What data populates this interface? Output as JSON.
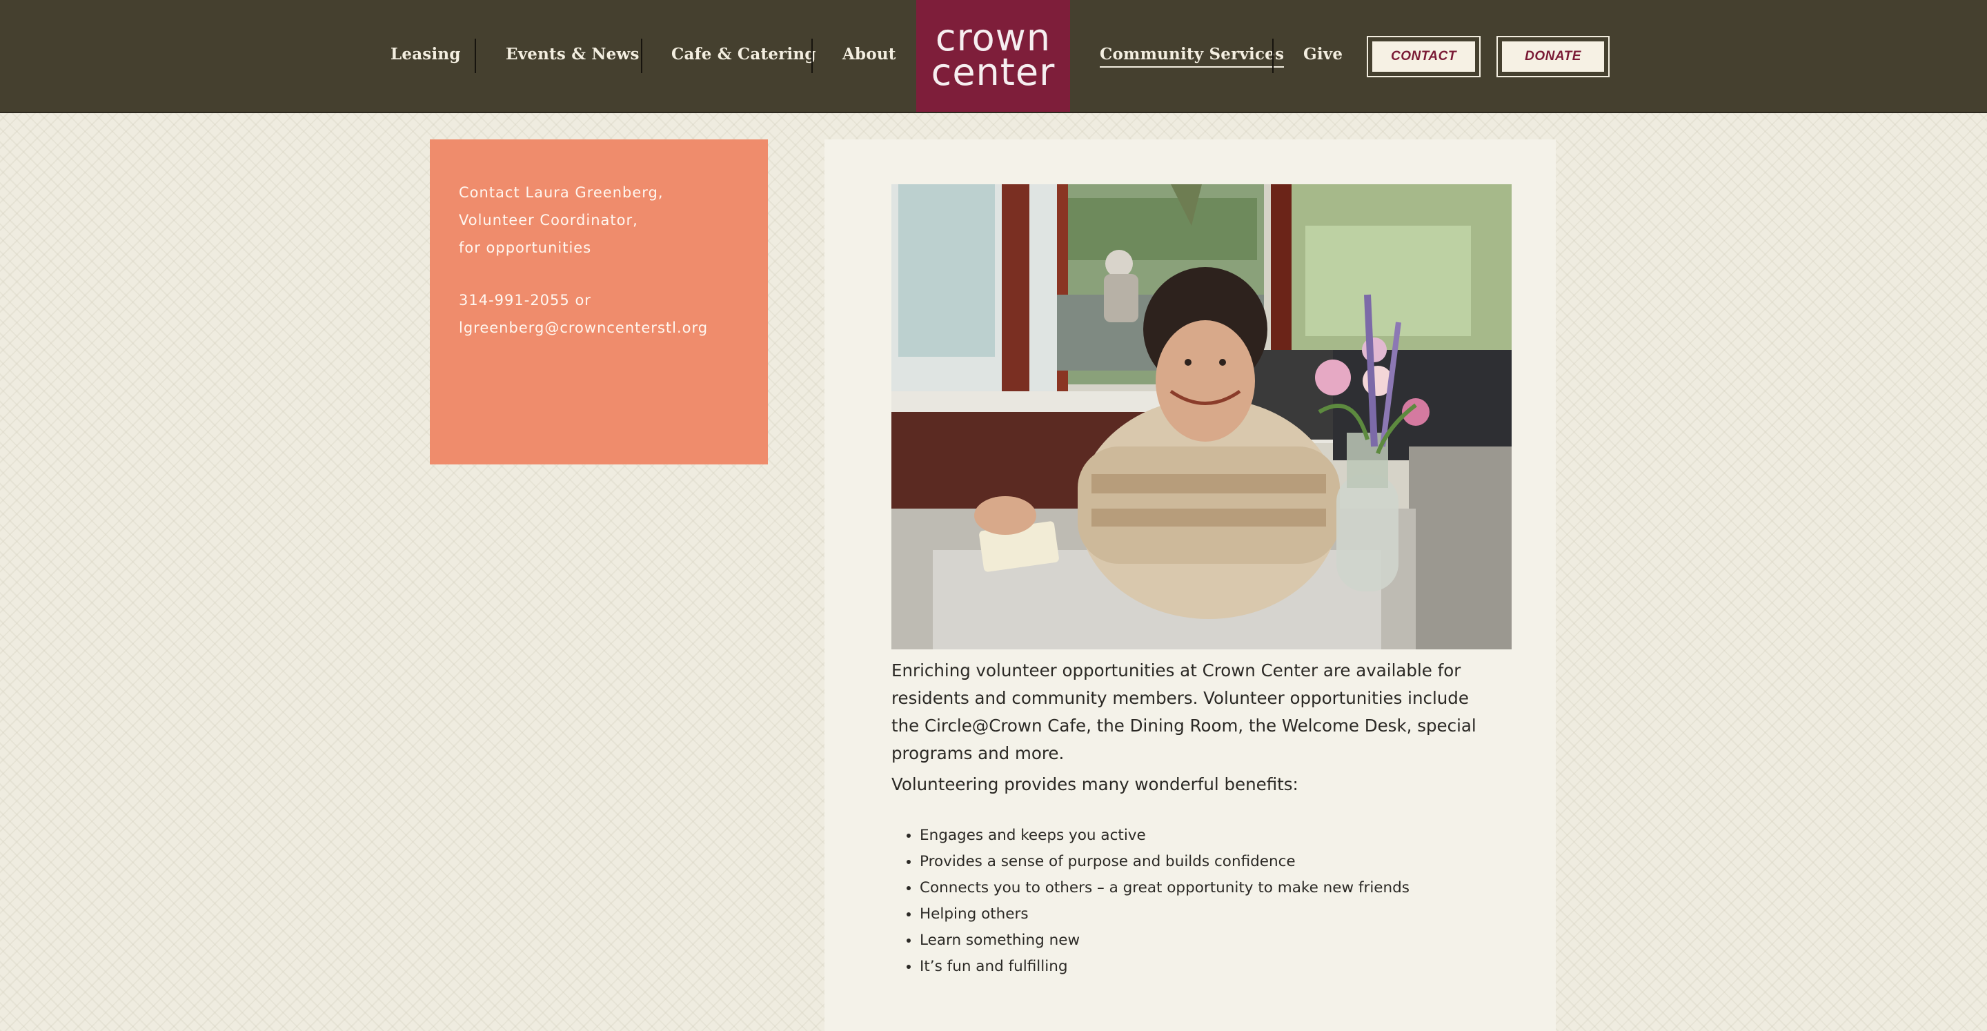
{
  "nav": {
    "items": [
      {
        "label": "Leasing"
      },
      {
        "label": "Events & News"
      },
      {
        "label": "Cafe & Catering"
      },
      {
        "label": "About"
      },
      {
        "label": "Community Services",
        "active": true
      },
      {
        "label": "Give"
      }
    ],
    "logo": {
      "line1": "crown",
      "line2": "center"
    },
    "contact_label": "CONTACT",
    "donate_label": "DONATE"
  },
  "sidebar": {
    "contact_lines": [
      "Contact Laura Greenberg,",
      "Volunteer Coordinator,",
      "for opportunities"
    ],
    "phone_line": "314-991-2055 or",
    "email": "lgreenberg@crowncenterstl.org"
  },
  "main": {
    "photo_alt": "Smiling volunteer seated at a cafe table with a vase of flowers",
    "intro": "Enriching volunteer opportunities at Crown Center are available for residents and community members. Volunteer opportunities include the Circle@Crown Cafe, the Dining Room, the Welcome Desk, special programs and more.",
    "benefits_title": "Volunteering provides many wonderful benefits:",
    "benefits": [
      "Engages and keeps you active",
      "Provides a sense of purpose and builds confidence",
      "Connects you to others – a great opportunity to make new friends",
      "Helping others",
      "Learn something new",
      "It’s fun and fulfilling"
    ]
  },
  "colors": {
    "nav_bg": "#45402f",
    "logo_bg": "#7e1e3a",
    "sidebar_bg": "#ef8c6c",
    "page_bg": "#efece0",
    "panel_bg": "#f4f2e9"
  }
}
